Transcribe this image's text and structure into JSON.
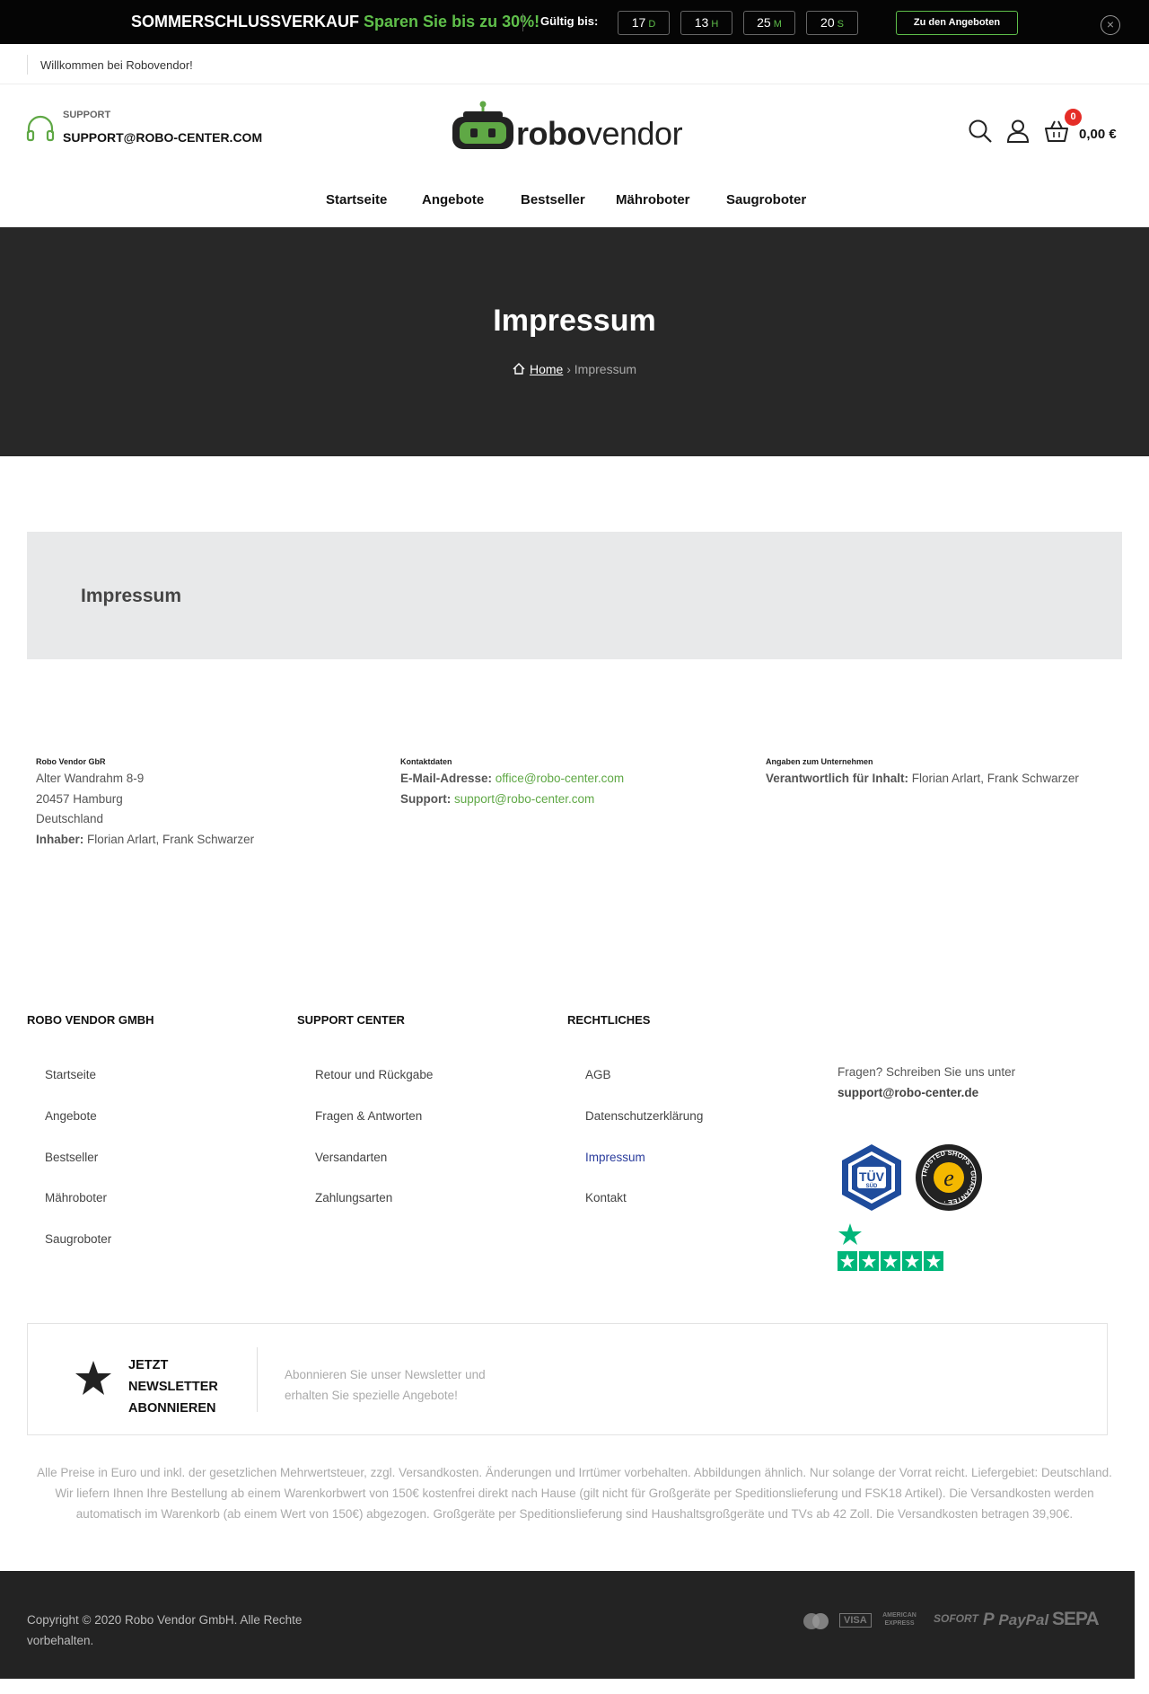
{
  "promo": {
    "title": "SOMMERSCHLUSSVERKAUF",
    "highlight": "Sparen Sie bis zu 30%!",
    "valid_label": "Gültig bis:",
    "countdown": [
      {
        "value": "17",
        "unit": "D"
      },
      {
        "value": "13",
        "unit": "H"
      },
      {
        "value": "25",
        "unit": "M"
      },
      {
        "value": "20",
        "unit": "S"
      }
    ],
    "button": "Zu den Angeboten",
    "close": "×",
    "accent_color": "#5fbf4a"
  },
  "welcome": "Willkommen bei Robovendor!",
  "header": {
    "support_label": "SUPPORT",
    "support_email": "SUPPORT@ROBO-CENTER.COM",
    "logo_bold": "robo",
    "logo_rest": "vendor",
    "cart_count": "0",
    "cart_total": "0,00 €"
  },
  "nav": [
    "Startseite",
    "Angebote",
    "Bestseller",
    "Mähroboter",
    "Saugroboter"
  ],
  "hero": {
    "title": "Impressum",
    "crumb_home": "Home",
    "crumb_sep": "›",
    "crumb_current": "Impressum"
  },
  "box_title": "Impressum",
  "company": {
    "head": "Robo Vendor GbR",
    "street": "Alter Wandrahm 8-9",
    "city": "20457 Hamburg",
    "country": "Deutschland",
    "owner_label": "Inhaber:",
    "owner": "Florian Arlart, Frank Schwarzer"
  },
  "contact": {
    "head": "Kontaktdaten",
    "email_label": "E-Mail-Adresse:",
    "email": "office@robo-center.com",
    "support_label": "Support:",
    "support": "support@robo-center.com"
  },
  "business": {
    "head": "Angaben zum Unternehmen",
    "resp_label": "Verantwortlich für Inhalt:",
    "resp": "Florian Arlart, Frank Schwarzer"
  },
  "footer": {
    "col1": {
      "title": "ROBO VENDOR GMBH",
      "links": [
        "Startseite",
        "Angebote",
        "Bestseller",
        "Mähroboter",
        "Saugroboter"
      ]
    },
    "col2": {
      "title": "SUPPORT CENTER",
      "links": [
        "Retour und Rückgabe",
        "Fragen & Antworten",
        "Versandarten",
        "Zahlungsarten"
      ]
    },
    "col3": {
      "title": "RECHTLICHES",
      "links": [
        "AGB",
        "Datenschutzerklärung",
        "Impressum",
        "Kontakt"
      ]
    },
    "contact_text": "Fragen? Schreiben Sie uns unter",
    "contact_email": "support@robo-center.de",
    "tuv_top": "TÜV",
    "tuv_bottom": "SÜD",
    "trusted_text": "TRUSTED SHOPS · GUARANTEE ·",
    "trusted_letter": "e"
  },
  "newsletter": {
    "line1": "JETZT",
    "line2": "NEWSLETTER",
    "line3": "ABONNIEREN",
    "text1": "Abonnieren Sie unser Newsletter und",
    "text2": "erhalten Sie spezielle Angebote!"
  },
  "legal": {
    "line1": "Alle Preise in Euro und inkl. der gesetzlichen Mehrwertsteuer, zzgl. Versandkosten. Änderungen und Irrtümer vorbehalten. Abbildungen ähnlich. Nur solange der Vorrat reicht. Liefergebiet: Deutschland.",
    "line2": "Wir liefern Ihnen Ihre Bestellung ab einem Warenkorbwert von 150€ kostenfrei direkt nach Hause (gilt nicht für Großgeräte per Speditionslieferung und FSK18 Artikel). Die Versandkosten werden automatisch im Warenkorb (ab einem Wert von 150€) abgezogen. Großgeräte per Speditionslieferung sind Haushaltsgroßgeräte und TVs ab 42 Zoll. Die Versandkosten betragen 39,90€."
  },
  "bottom": {
    "copyright": "Copyright © 2020 Robo Vendor GmbH. Alle Rechte vorbehalten.",
    "payments": {
      "visa": "VISA",
      "amex": "AMERICAN EXPRESS",
      "sofort": "SOFORT",
      "paypal": "PayPal",
      "sepa": "SEPA"
    }
  }
}
